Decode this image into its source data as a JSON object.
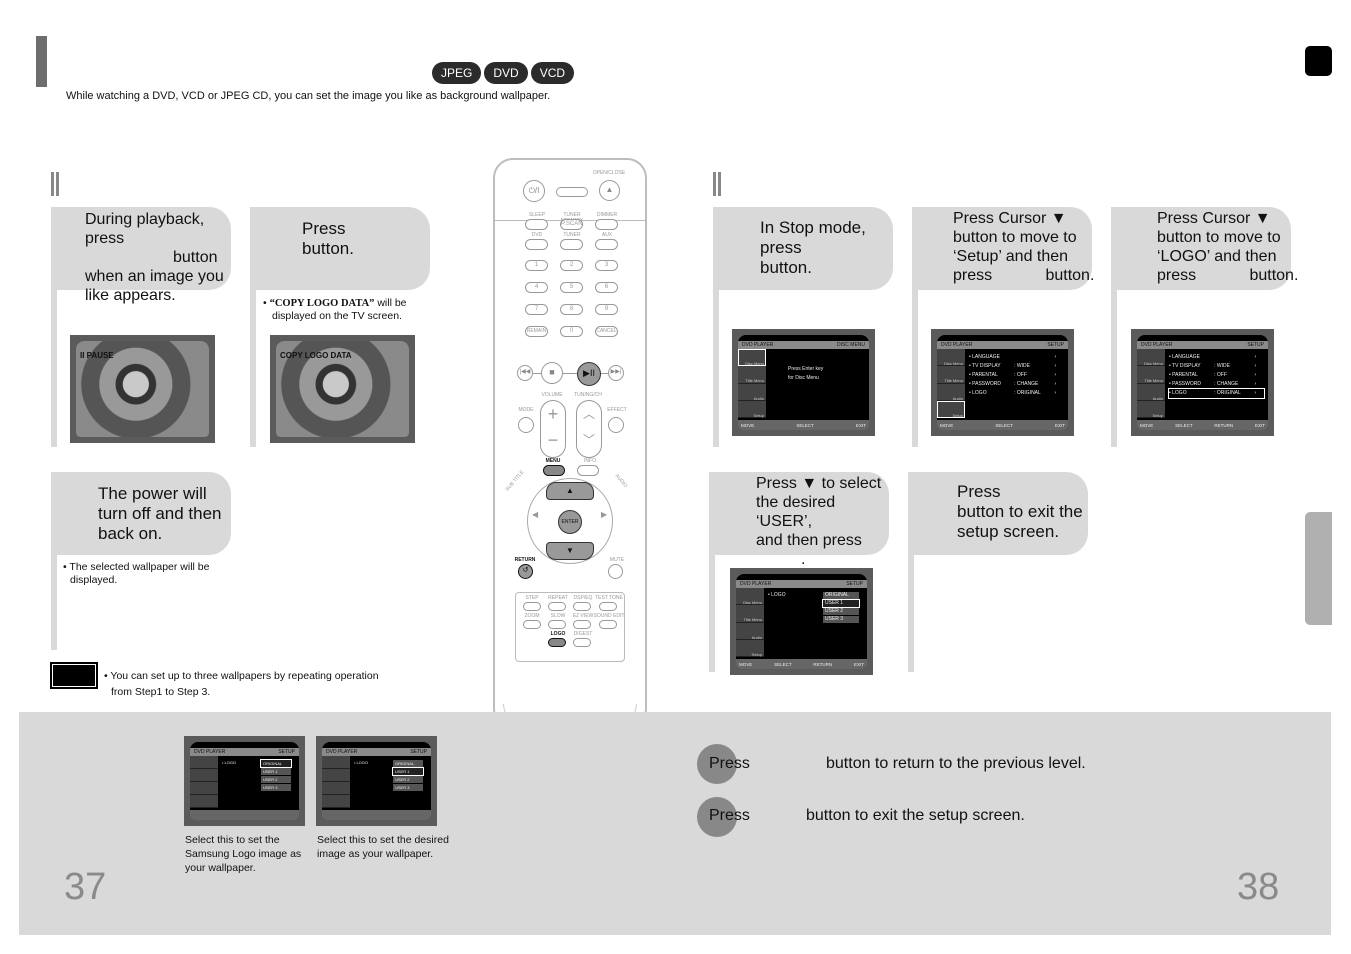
{
  "header": {
    "badges": [
      "JPEG",
      "DVD",
      "VCD"
    ],
    "intro": "While watching a DVD, VCD or JPEG CD, you can set the image you like as background wallpaper."
  },
  "left_section": {
    "step1": {
      "text_lines": [
        "During playback, press",
        "button",
        "when an image you",
        "like appears."
      ],
      "screen_label": "II PAUSE"
    },
    "step2": {
      "text_lines": [
        "Press",
        "button."
      ],
      "note_bold": "“COPY LOGO DATA”",
      "note_rest": " will be",
      "note_line2": "displayed on the TV screen.",
      "screen_label": "COPY LOGO DATA"
    },
    "step3": {
      "text_lines": [
        "The power will",
        "turn off and then",
        "back on."
      ],
      "note_line1": "The selected wallpaper will be",
      "note_line2": "displayed."
    },
    "tip": {
      "line1": "You can set up to three wallpapers by repeating operation",
      "line2": "from Step1 to Step 3."
    }
  },
  "remote": {
    "labels": {
      "open_close": "OPEN/CLOSE",
      "power": "⏻/I",
      "sleep": "SLEEP",
      "tuner_memory": "TUNER MEMORY",
      "pscan": "P.SCAN",
      "dimmer": "DIMMER",
      "dvd": "DVD",
      "tuner": "TUNER",
      "aux": "AUX",
      "remain": "REMAIN",
      "cancel": "CANCEL",
      "volume": "VOLUME",
      "tuning_ch": "TUNING/CH",
      "mode": "MODE",
      "effect": "EFFECT",
      "menu": "MENU",
      "info": "INFO",
      "subtitle": "SUB TITLE",
      "audio": "AUDIO",
      "enter": "ENTER",
      "return": "RETURN",
      "mute": "MUTE",
      "step": "STEP",
      "repeat": "REPEAT",
      "dsp_eq": "DSP/EQ",
      "test_tone": "TEST TONE",
      "zoom": "ZOOM",
      "slow": "SLOW",
      "ez_view": "EZ VIEW",
      "sound_edit": "SOUND EDIT",
      "logo": "LOGO",
      "digest": "DIGEST"
    },
    "digits": [
      "1",
      "2",
      "3",
      "4",
      "5",
      "6",
      "7",
      "8",
      "9",
      "0"
    ]
  },
  "right_section": {
    "step1": {
      "text_lines": [
        "In Stop mode,",
        "press",
        "button."
      ]
    },
    "step2": {
      "text_lines": [
        "Press Cursor ▼",
        "button to move to",
        "‘Setup’ and then",
        "press            button."
      ]
    },
    "step3": {
      "text_lines": [
        "Press Cursor ▼",
        "button to move to",
        "‘LOGO’ and then",
        "press            button."
      ]
    },
    "step4": {
      "text_lines": [
        "Press ▼ to select",
        "the desired ‘USER’,",
        "and then press",
        "."
      ]
    },
    "step5": {
      "text_lines": [
        "Press",
        "button to exit the",
        "setup screen."
      ]
    }
  },
  "screens": {
    "disc_menu": {
      "header_left": "DVD PLAYER",
      "header_right": "DISC MENU",
      "side": [
        "Disc Menu",
        "Title Menu",
        "Audio",
        "Setup"
      ],
      "body": [
        "Press Enter key",
        "for Disc Menu"
      ],
      "footer": [
        "MOVE",
        "SELECT",
        "EXIT"
      ]
    },
    "setup_menu": {
      "header_left": "DVD PLAYER",
      "header_right": "SETUP",
      "rows": [
        [
          "LANGUAGE",
          "",
          "›"
        ],
        [
          "TV DISPLAY",
          ": WIDE",
          "›"
        ],
        [
          "PARENTAL",
          ": OFF",
          "›"
        ],
        [
          "PASSWORD",
          ": CHANGE",
          "›"
        ],
        [
          "LOGO",
          ": ORIGINAL",
          "›"
        ]
      ],
      "footer": [
        "MOVE",
        "SELECT",
        "EXIT"
      ],
      "footer2": [
        "MOVE",
        "SELECT",
        "RETURN",
        "EXIT"
      ]
    },
    "logo_menu": {
      "header_left": "DVD PLAYER",
      "header_right": "SETUP",
      "label": "• LOGO",
      "options": [
        "ORIGINAL",
        "USER 1",
        "USER 2",
        "USER 3"
      ],
      "footer": [
        "MOVE",
        "SELECT",
        "RETURN",
        "EXIT"
      ]
    }
  },
  "bottom": {
    "caption1": [
      "Select this to set the",
      "Samsung Logo image as",
      "your wallpaper."
    ],
    "caption2": [
      "Select this to set the desired",
      "image as your wallpaper."
    ],
    "press1": {
      "press": "Press",
      "text": "button to return to the previous level."
    },
    "press2": {
      "press": "Press",
      "text": "button to exit the setup screen."
    },
    "page_left": "37",
    "page_right": "38"
  }
}
